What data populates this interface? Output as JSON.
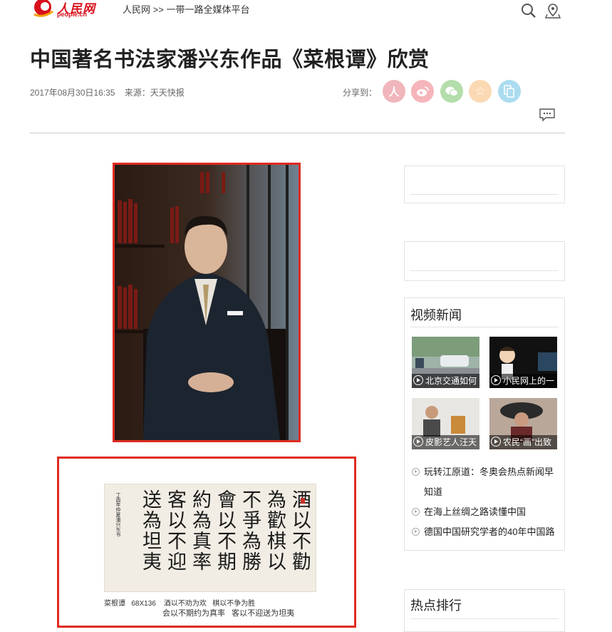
{
  "header": {
    "logo_text": "人民网",
    "logo_sub": "people.cn",
    "breadcrumb_home": "人民网",
    "breadcrumb_sep": " >> ",
    "breadcrumb_channel": "一带一路全媒体平台",
    "icons": [
      "search-icon",
      "location-icon"
    ]
  },
  "article": {
    "title": "中国著名书法家潘兴东作品《菜根谭》欣赏",
    "date": "2017年08月30日16:35",
    "source": "来源：天天快报",
    "share_label": "分享到：",
    "share_buttons": [
      {
        "name": "people-share",
        "glyph": "人",
        "color": "#f0a5ac"
      },
      {
        "name": "weibo-share",
        "glyph": "微",
        "color": "#f5aab0"
      },
      {
        "name": "wechat-share",
        "glyph": "●",
        "color": "#a9dca0"
      },
      {
        "name": "favorite-share",
        "glyph": "☆",
        "color": "#f8d4a6"
      },
      {
        "name": "copy-share",
        "glyph": "⧉",
        "color": "#9fd8ec"
      }
    ]
  },
  "calligraphy": {
    "columns": [
      "酒以不勸",
      "為歡棋以",
      "不爭為勝",
      "會以不期",
      "約為真率",
      "客以不迎",
      "送為坦夷"
    ],
    "inscription": "丁酉年仲夏潘兴东书",
    "caption_line1": "菜根谭   68X136    酒以不劝为欢   棋以不争为胜",
    "caption_line2": "会以不期约为真率   客以不迎送为坦夷"
  },
  "sidebar": {
    "video_title": "视频新闻",
    "videos": [
      {
        "caption": "北京交通如何"
      },
      {
        "caption": "小民网上的一"
      },
      {
        "caption": "皮影艺人汪天"
      },
      {
        "caption": "农民“画”出致"
      }
    ],
    "news": [
      "玩转江原道：冬奥会热点新闻早知道",
      "在海上丝绸之路读懂中国",
      "德国中国研究学者的40年中国路"
    ],
    "hot_title": "热点排行"
  }
}
